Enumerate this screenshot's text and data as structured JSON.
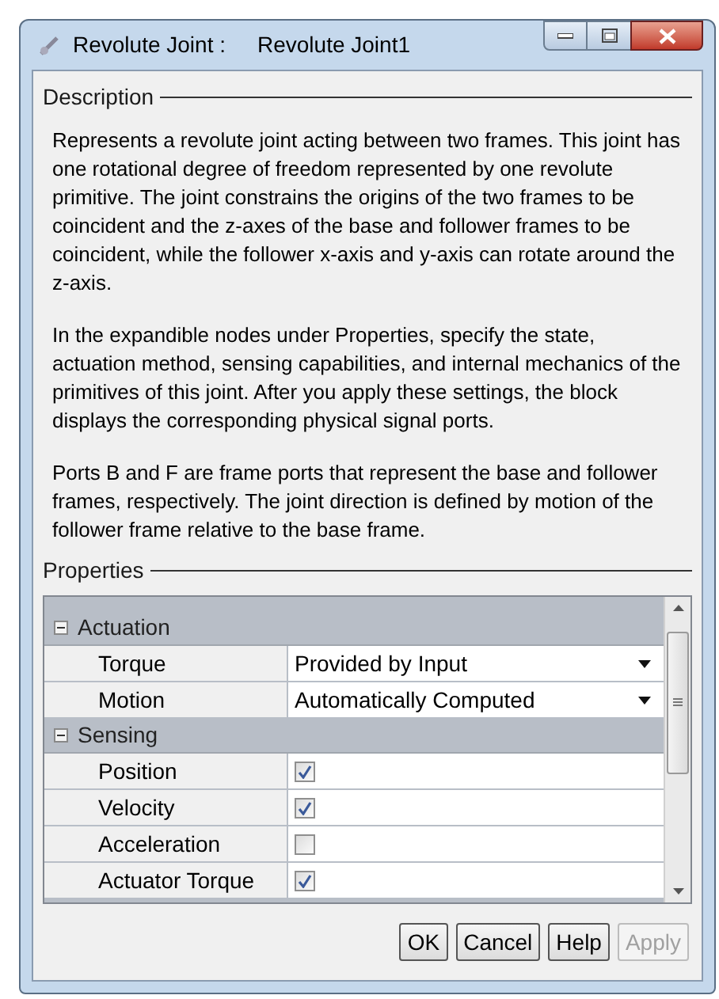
{
  "window": {
    "title_label": "Revolute Joint :",
    "title_name": "Revolute Joint1"
  },
  "description": {
    "heading": "Description",
    "paragraphs": [
      "Represents a revolute joint acting between two frames. This joint has one rotational degree of freedom represented by one revolute primitive. The joint constrains the origins of the two frames to be coincident and the z-axes of the base and follower frames to be coincident, while the follower x-axis and y-axis can rotate around the z-axis.",
      "In the expandible nodes under Properties, specify the state, actuation method, sensing capabilities, and internal mechanics of the primitives of this joint. After you apply these settings, the block displays the corresponding physical signal ports.",
      "Ports B and F are frame ports that represent the base and follower frames, respectively. The joint direction is defined by motion of the follower frame relative to the base frame."
    ]
  },
  "properties": {
    "heading": "Properties",
    "groups": [
      {
        "label": "Actuation",
        "expanded": true,
        "rows": [
          {
            "kind": "dropdown",
            "label": "Torque",
            "value": "Provided by Input"
          },
          {
            "kind": "dropdown",
            "label": "Motion",
            "value": "Automatically Computed"
          }
        ]
      },
      {
        "label": "Sensing",
        "expanded": true,
        "rows": [
          {
            "kind": "checkbox",
            "label": "Position",
            "checked": true
          },
          {
            "kind": "checkbox",
            "label": "Velocity",
            "checked": true
          },
          {
            "kind": "checkbox",
            "label": "Acceleration",
            "checked": false
          },
          {
            "kind": "checkbox",
            "label": "Actuator Torque",
            "checked": true
          }
        ]
      }
    ]
  },
  "buttons": [
    {
      "label": "OK",
      "disabled": false
    },
    {
      "label": "Cancel",
      "disabled": false
    },
    {
      "label": "Help",
      "disabled": false
    },
    {
      "label": "Apply",
      "disabled": true
    }
  ]
}
